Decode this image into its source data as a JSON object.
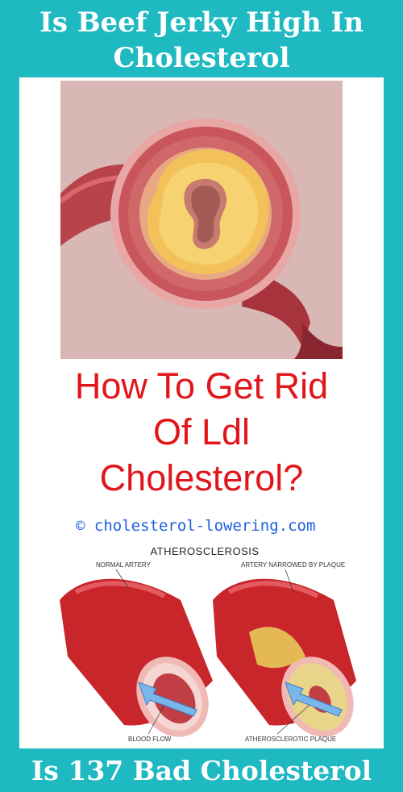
{
  "header": {
    "title_line1": "Is Beef Jerky High In",
    "title_line2": "Cholesterol"
  },
  "headline": {
    "line1": "How To Get Rid",
    "line2": "Of Ldl",
    "line3": "Cholesterol?"
  },
  "copyright": "© cholesterol-lowering.com",
  "diagram": {
    "title": "ATHEROSCLEROSIS",
    "label_normal": "NORMAL ARTERY",
    "label_narrowed": "ARTERY NARROWED BY PLAQUE",
    "label_flow": "BLOOD FLOW",
    "label_plaque": "ATHEROSCLEROTIC PLAQUE"
  },
  "footer": {
    "title": "Is 137 Bad Cholesterol"
  }
}
